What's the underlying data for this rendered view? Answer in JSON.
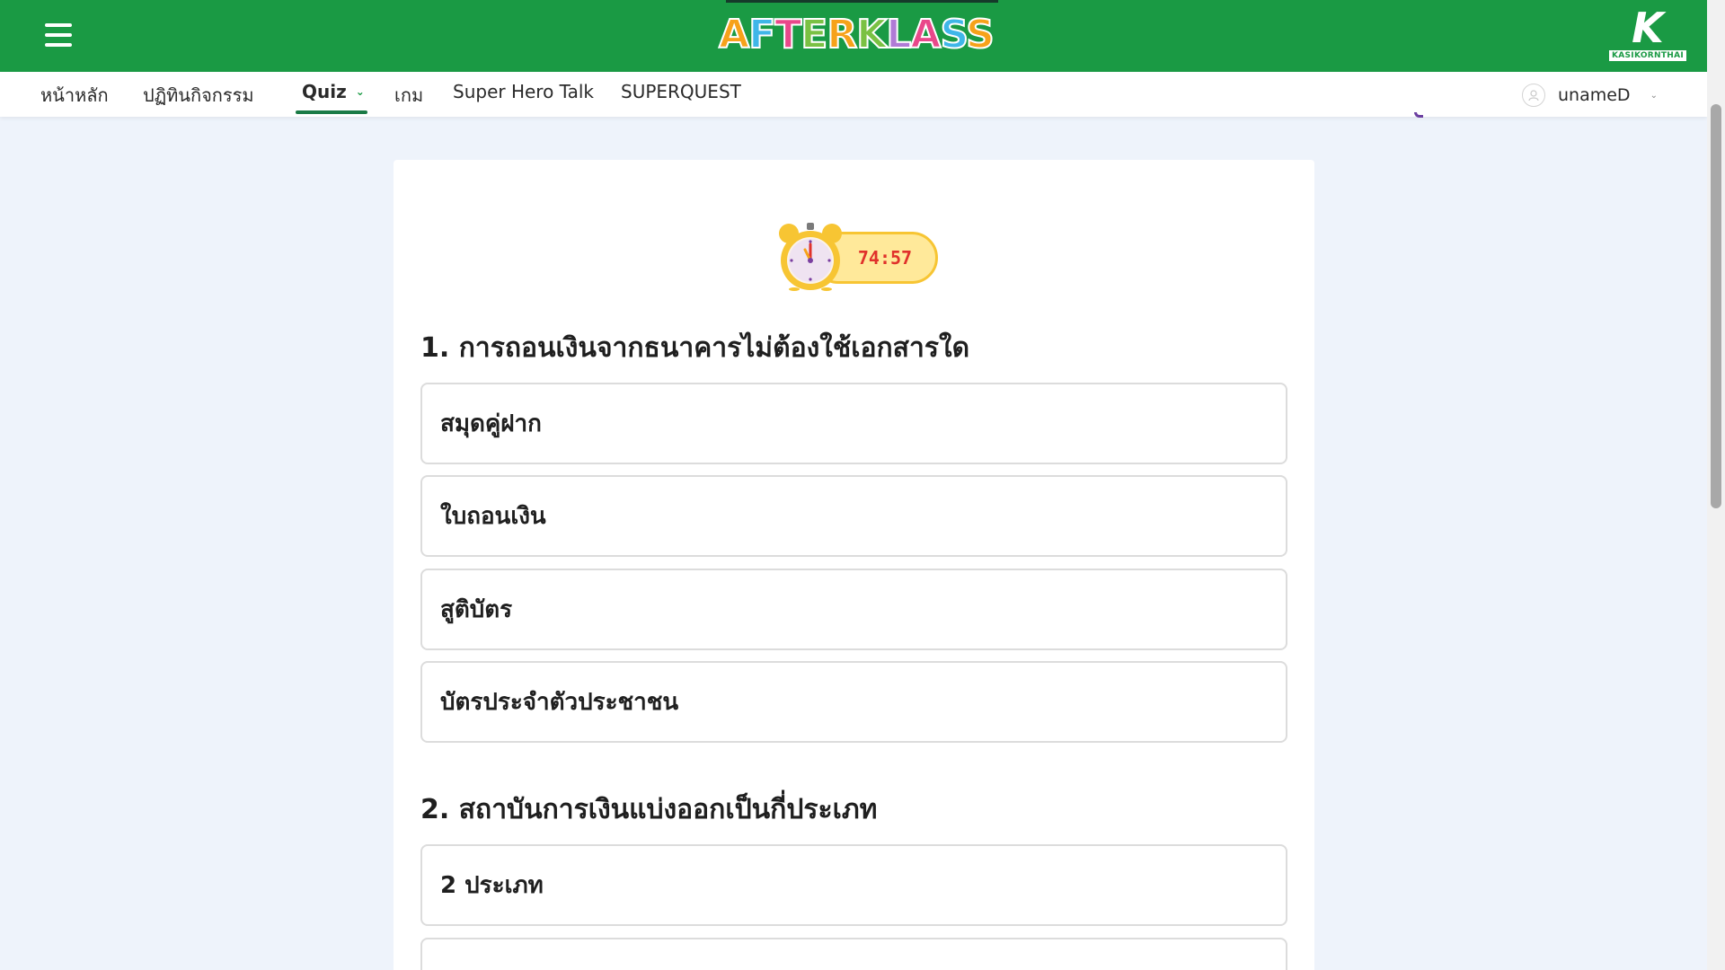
{
  "header": {
    "logo_text": [
      "A",
      "F",
      "T",
      "E",
      "R",
      "K",
      "L",
      "A",
      "S",
      "S"
    ],
    "brand_letter": "K",
    "brand_label": "KASIKORNTHAI",
    "menu_icon": "hamburger-icon"
  },
  "nav": {
    "items": [
      {
        "label": "หน้าหลัก"
      },
      {
        "label": "ปฏิทินกิจกรรม"
      },
      {
        "label": "Quiz"
      },
      {
        "label": "เกม"
      },
      {
        "label": "Super Hero Talk"
      },
      {
        "label": "SUPERQUEST"
      }
    ],
    "active": "Quiz",
    "user": {
      "name": "unameD",
      "icon": "user-icon"
    }
  },
  "quiz": {
    "timer": "74:57",
    "questions": [
      {
        "text": "1. การถอนเงินจากธนาคารไม่ต้องใช้เอกสารใด",
        "options": [
          "สมุดคู่ฝาก",
          "ใบถอนเงิน",
          "สูติบัตร",
          "บัตรประจำตัวประชาชน"
        ]
      },
      {
        "text": "2. สถาบันการเงินแบ่งออกเป็นกี่ประเภท",
        "options": [
          "2 ประเภท",
          ""
        ]
      }
    ]
  },
  "colors": {
    "header_green": "#1a9a44",
    "timer_red": "#e0312b",
    "timer_pill": "#ffe99a",
    "page_bg": "#eef3fb"
  }
}
